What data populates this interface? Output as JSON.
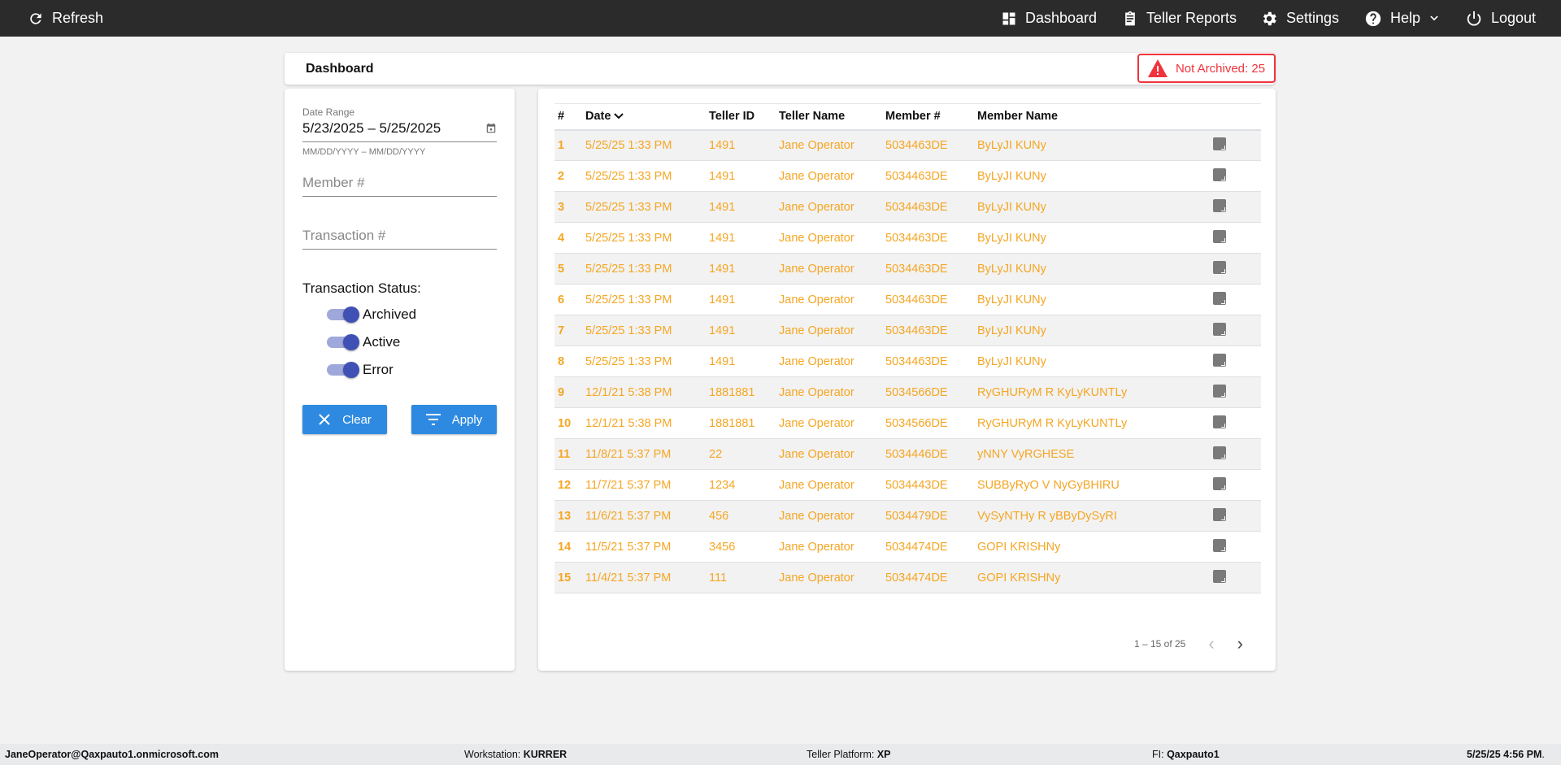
{
  "topbar": {
    "refresh": "Refresh",
    "dashboard": "Dashboard",
    "teller_reports": "Teller Reports",
    "settings": "Settings",
    "help": "Help",
    "logout": "Logout"
  },
  "header": {
    "title": "Dashboard",
    "not_archived": "Not Archived: 25",
    "alert_color": "#f0333c"
  },
  "filters": {
    "date_range_label": "Date Range",
    "date_range_value": "5/23/2025 – 5/25/2025",
    "date_hint": "MM/DD/YYYY – MM/DD/YYYY",
    "member_placeholder": "Member #",
    "transaction_placeholder": "Transaction #",
    "status_label": "Transaction Status:",
    "toggles": [
      {
        "label": "Archived",
        "on": true
      },
      {
        "label": "Active",
        "on": true
      },
      {
        "label": "Error",
        "on": true
      }
    ],
    "clear": "Clear",
    "apply": "Apply"
  },
  "table": {
    "columns": [
      "#",
      "Date",
      "Teller ID",
      "Teller Name",
      "Member #",
      "Member Name"
    ],
    "rows": [
      [
        "1",
        "5/25/25 1:33 PM",
        "1491",
        "Jane Operator",
        "5034463DE",
        "ByLyJI KUNy"
      ],
      [
        "2",
        "5/25/25 1:33 PM",
        "1491",
        "Jane Operator",
        "5034463DE",
        "ByLyJI KUNy"
      ],
      [
        "3",
        "5/25/25 1:33 PM",
        "1491",
        "Jane Operator",
        "5034463DE",
        "ByLyJI KUNy"
      ],
      [
        "4",
        "5/25/25 1:33 PM",
        "1491",
        "Jane Operator",
        "5034463DE",
        "ByLyJI KUNy"
      ],
      [
        "5",
        "5/25/25 1:33 PM",
        "1491",
        "Jane Operator",
        "5034463DE",
        "ByLyJI KUNy"
      ],
      [
        "6",
        "5/25/25 1:33 PM",
        "1491",
        "Jane Operator",
        "5034463DE",
        "ByLyJI KUNy"
      ],
      [
        "7",
        "5/25/25 1:33 PM",
        "1491",
        "Jane Operator",
        "5034463DE",
        "ByLyJI KUNy"
      ],
      [
        "8",
        "5/25/25 1:33 PM",
        "1491",
        "Jane Operator",
        "5034463DE",
        "ByLyJI KUNy"
      ],
      [
        "9",
        "12/1/21 5:38 PM",
        "1881881",
        "Jane Operator",
        "5034566DE",
        "RyGHURyM R KyLyKUNTLy"
      ],
      [
        "10",
        "12/1/21 5:38 PM",
        "1881881",
        "Jane Operator",
        "5034566DE",
        "RyGHURyM R KyLyKUNTLy"
      ],
      [
        "11",
        "11/8/21 5:37 PM",
        "22",
        "Jane Operator",
        "5034446DE",
        "yNNY VyRGHESE"
      ],
      [
        "12",
        "11/7/21 5:37 PM",
        "1234",
        "Jane Operator",
        "5034443DE",
        "SUBByRyO V NyGyBHIRU"
      ],
      [
        "13",
        "11/6/21 5:37 PM",
        "456",
        "Jane Operator",
        "5034479DE",
        "VySyNTHy R yBByDySyRI"
      ],
      [
        "14",
        "11/5/21 5:37 PM",
        "3456",
        "Jane Operator",
        "5034474DE",
        "GOPI KRISHNy"
      ],
      [
        "15",
        "11/4/21 5:37 PM",
        "111",
        "Jane Operator",
        "5034474DE",
        "GOPI KRISHNy"
      ]
    ],
    "row_color": "#f5a623",
    "pagination": "1 – 15 of 25"
  },
  "footer": {
    "user": "JaneOperator@Qaxpauto1.onmicrosoft.com",
    "workstation_label": "Workstation: ",
    "workstation": "KURRER",
    "platform_label": "Teller Platform: ",
    "platform": "XP",
    "fi_label": "FI: ",
    "fi": "Qaxpauto1",
    "datetime": "5/25/25 4:56 PM",
    "datetime_suffix": "."
  }
}
